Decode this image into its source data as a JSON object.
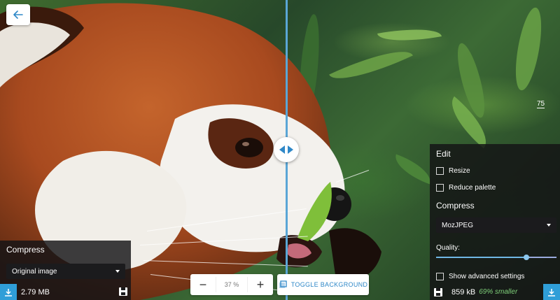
{
  "app": {
    "back_icon": "arrow-left-icon"
  },
  "left_panel": {
    "title": "Compress",
    "method_select": "Original image",
    "file_size": "2.79 MB",
    "download_icon": "download-icon",
    "save_icon": "save-icon"
  },
  "right_panel": {
    "edit_title": "Edit",
    "resize_label": "Resize",
    "reduce_palette_label": "Reduce palette",
    "compress_title": "Compress",
    "method_select": "MozJPEG",
    "quality_label": "Quality:",
    "quality_value": "75",
    "quality_level": 0.75,
    "advanced_label": "Show advanced settings",
    "file_size": "859 kB",
    "savings": "69% smaller",
    "download_icon": "download-icon",
    "save_icon": "save-icon"
  },
  "zoom": {
    "minus_label": "−",
    "value": "37",
    "unit": "%",
    "plus_label": "+"
  },
  "toggle": {
    "label": "TOGGLE BACKGROUND",
    "icon": "toggle-background-icon"
  },
  "colors": {
    "accent": "#2f9ed8",
    "divider": "#5aa6d6",
    "savings_text": "#7fd07a"
  }
}
